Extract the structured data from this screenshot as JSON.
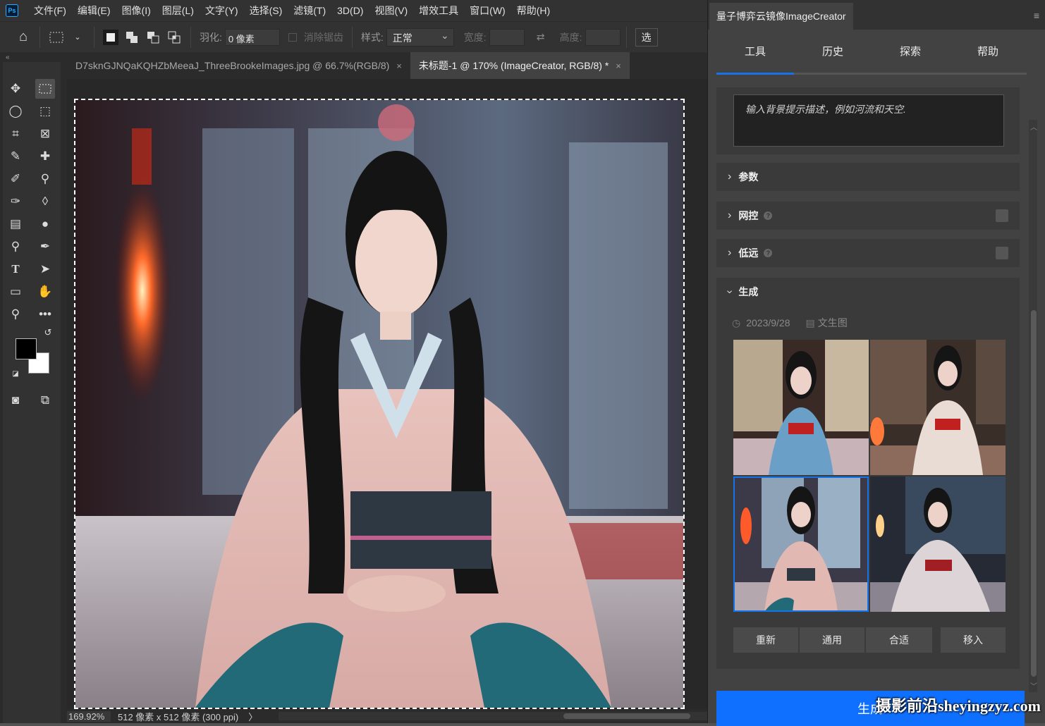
{
  "app": {
    "logo": "Ps"
  },
  "menu": [
    "文件(F)",
    "编辑(E)",
    "图像(I)",
    "图层(L)",
    "文字(Y)",
    "选择(S)",
    "滤镜(T)",
    "3D(D)",
    "视图(V)",
    "增效工具",
    "窗口(W)",
    "帮助(H)"
  ],
  "options": {
    "feather_label": "羽化:",
    "feather_value": "0 像素",
    "antialias_label": "消除锯齿",
    "style_label": "样式:",
    "style_value": "正常",
    "width_label": "宽度:",
    "height_label": "高度:",
    "select_label": "选"
  },
  "doc_tabs": [
    {
      "title": "D7sknGJNQaKQHZbMeeaJ_ThreeBrookeImages.jpg @ 66.7%(RGB/8)",
      "close": "×"
    },
    {
      "title": "未标题-1 @ 170% (ImageCreator, RGB/8) *",
      "close": "×"
    }
  ],
  "status": {
    "zoom": "169.92%",
    "info": "512 像素 x 512 像素 (300 ppi)",
    "arrow": "〉"
  },
  "panel": {
    "title": "量子博弈云镜像ImageCreator",
    "menu_icon": "≡",
    "tabs": [
      "工具",
      "历史",
      "探索",
      "帮助"
    ],
    "prompt_placeholder": "输入背景提示描述，例如河流和天空.",
    "sections": {
      "params": "参数",
      "netcontrol": "网控",
      "lowres": "低远",
      "generate": "生成"
    },
    "meta_date": "2023/9/28",
    "meta_type": "文生图",
    "buttons": [
      "重新",
      "通用",
      "合适",
      "移入"
    ],
    "generate_button": "生成",
    "watermark": "摄影前沿sheyingzyz.com"
  },
  "colors": {
    "accent": "#1473e6",
    "generate": "#0f6fff"
  }
}
